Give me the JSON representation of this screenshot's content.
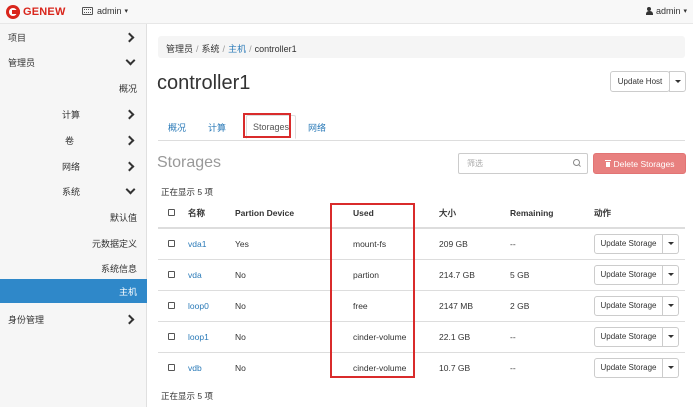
{
  "topbar": {
    "brand": "GENEW",
    "project_label": "admin",
    "user_label": "admin"
  },
  "sidebar": {
    "items": [
      {
        "label": "项目"
      },
      {
        "label": "管理员"
      },
      {
        "label": "概况"
      },
      {
        "label": "计算"
      },
      {
        "label": "卷"
      },
      {
        "label": "网络"
      },
      {
        "label": "系统"
      },
      {
        "label": "默认值"
      },
      {
        "label": "元数据定义"
      },
      {
        "label": "系统信息"
      },
      {
        "label": "主机"
      },
      {
        "label": "身份管理"
      }
    ]
  },
  "breadcrumb": {
    "items": [
      "管理员",
      "系统",
      "主机",
      "controller1"
    ]
  },
  "page": {
    "title": "controller1",
    "update_host_label": "Update Host"
  },
  "tabs": [
    "概况",
    "计算",
    "Storages",
    "网络"
  ],
  "storages": {
    "title": "Storages",
    "filter_placeholder": "筛选",
    "delete_label": "Delete Storages",
    "count_text_top": "正在显示 5 项",
    "count_text_bottom": "正在显示 5 项",
    "columns": [
      "名称",
      "Partion Device",
      "Used",
      "大小",
      "Remaining",
      "动作"
    ],
    "rows": [
      {
        "name": "vda1",
        "partion": "Yes",
        "used": "mount-fs",
        "size": "209 GB",
        "remaining": "--",
        "action": "Update Storage"
      },
      {
        "name": "vda",
        "partion": "No",
        "used": "partion",
        "size": "214.7 GB",
        "remaining": "5 GB",
        "action": "Update Storage"
      },
      {
        "name": "loop0",
        "partion": "No",
        "used": "free",
        "size": "2147 MB",
        "remaining": "2 GB",
        "action": "Update Storage"
      },
      {
        "name": "loop1",
        "partion": "No",
        "used": "cinder-volume",
        "size": "22.1 GB",
        "remaining": "--",
        "action": "Update Storage"
      },
      {
        "name": "vdb",
        "partion": "No",
        "used": "cinder-volume",
        "size": "10.7 GB",
        "remaining": "--",
        "action": "Update Storage"
      }
    ]
  },
  "colors": {
    "brand": "#d9261c",
    "accent": "#2f88c9",
    "danger": "#e8807f",
    "highlight": "#d92b2b"
  }
}
